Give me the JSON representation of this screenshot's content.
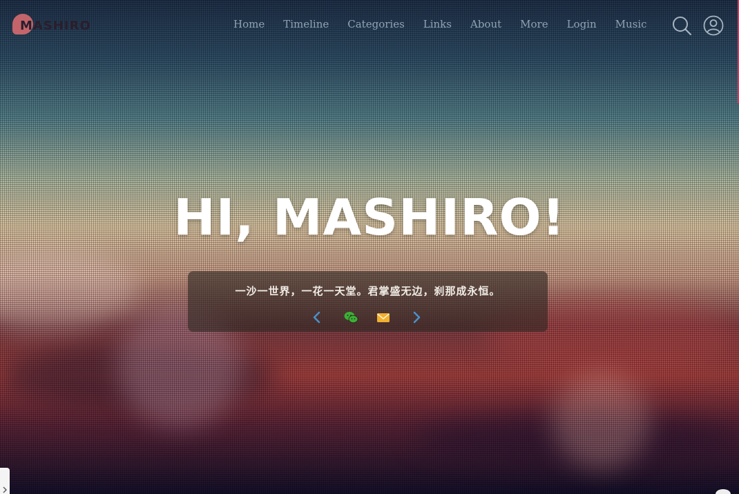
{
  "brand": {
    "logo_text": "MASHIRO",
    "accent_color": "#d66a6f"
  },
  "nav": {
    "items": [
      {
        "label": "Home"
      },
      {
        "label": "Timeline"
      },
      {
        "label": "Categories"
      },
      {
        "label": "Links"
      },
      {
        "label": "About"
      },
      {
        "label": "More"
      },
      {
        "label": "Login"
      },
      {
        "label": "Music"
      }
    ],
    "search_icon": "search-icon",
    "user_icon": "user-icon"
  },
  "hero": {
    "title": "HI, MASHIRO!",
    "motto": "一沙一世界，一花一天堂。君掌盛无边，刹那成永恒。",
    "icons": [
      "chevron-left-icon",
      "wechat-icon",
      "mail-icon",
      "chevron-right-icon"
    ]
  },
  "colors": {
    "prev_arrow": "#4a90c9",
    "wechat": "#3cb034",
    "mail": "#f0b030",
    "next_arrow": "#4a90c9",
    "edge_bar": "#d9345b"
  }
}
